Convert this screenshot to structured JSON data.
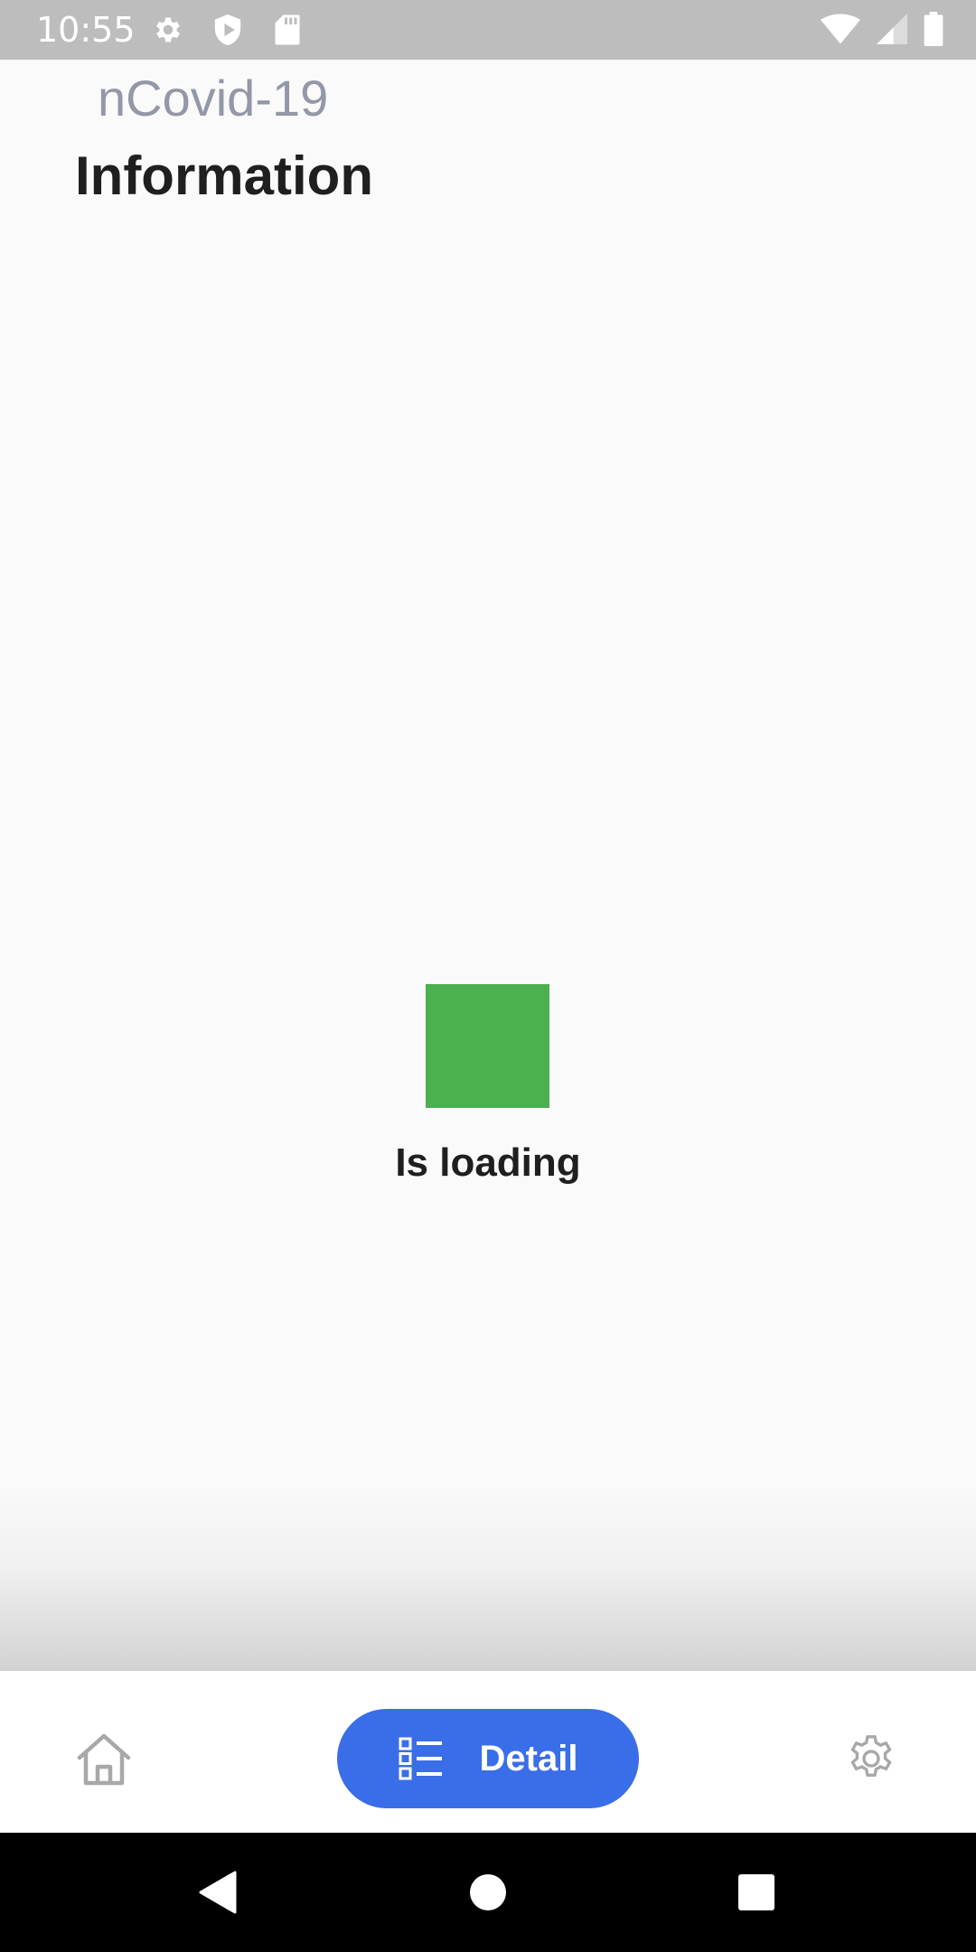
{
  "status_bar": {
    "time": "10:55",
    "left_icons": [
      "settings-icon",
      "shield-play-icon",
      "sd-card-icon"
    ],
    "right_icons": [
      "wifi-icon",
      "cell-signal-icon",
      "battery-icon"
    ]
  },
  "header": {
    "subtitle": "nCovid-19",
    "title": "Information"
  },
  "loading": {
    "text": "Is loading",
    "indicator_color": "#4caf50"
  },
  "bottom_nav": {
    "items": [
      {
        "name": "home",
        "icon": "home-icon",
        "label": "",
        "active": false
      },
      {
        "name": "detail",
        "icon": "list-icon",
        "label": "Detail",
        "active": true
      },
      {
        "name": "settings",
        "icon": "gear-icon",
        "label": "",
        "active": false
      }
    ],
    "active_color": "#3a6ee8",
    "inactive_icon_color": "#a8a8a8"
  },
  "system_nav": {
    "buttons": [
      "back-icon",
      "home-circle-icon",
      "recents-icon"
    ]
  }
}
